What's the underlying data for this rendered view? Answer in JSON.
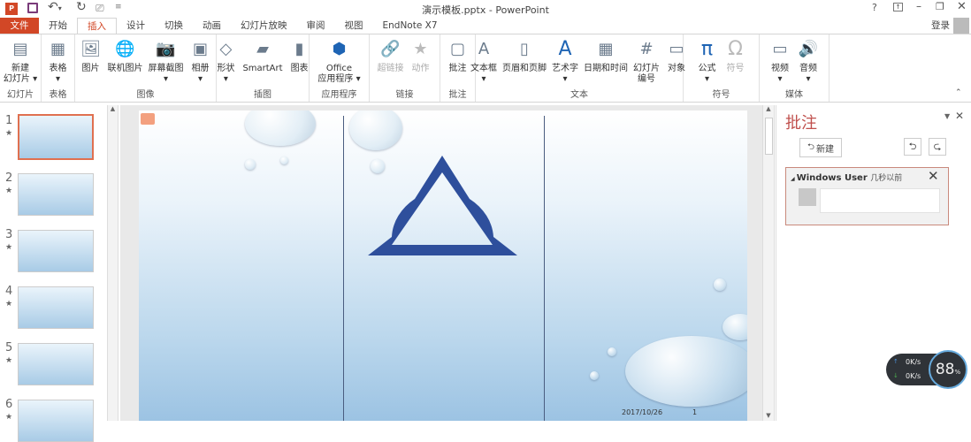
{
  "window": {
    "title": "演示模板.pptx - PowerPoint",
    "help": "?",
    "signin": "登录"
  },
  "tabs": [
    "文件",
    "开始",
    "插入",
    "设计",
    "切换",
    "动画",
    "幻灯片放映",
    "审阅",
    "视图",
    "EndNote X7"
  ],
  "ribbon": {
    "groups": [
      {
        "label": "幻灯片",
        "buttons": [
          {
            "label": "新建\n幻灯片 ▾",
            "icon": "new-slide-icon"
          }
        ]
      },
      {
        "label": "表格",
        "buttons": [
          {
            "label": "表格\n▾",
            "icon": "table-icon"
          }
        ]
      },
      {
        "label": "图像",
        "buttons": [
          {
            "label": "图片",
            "icon": "picture-icon"
          },
          {
            "label": "联机图片",
            "icon": "online-picture-icon"
          },
          {
            "label": "屏幕截图\n▾",
            "icon": "screenshot-icon"
          },
          {
            "label": "相册\n▾",
            "icon": "photo-album-icon"
          }
        ]
      },
      {
        "label": "插图",
        "buttons": [
          {
            "label": "形状\n▾",
            "icon": "shapes-icon"
          },
          {
            "label": "SmartArt",
            "icon": "smartart-icon"
          },
          {
            "label": "图表",
            "icon": "chart-icon"
          }
        ]
      },
      {
        "label": "应用程序",
        "buttons": [
          {
            "label": "Office\n应用程序 ▾",
            "icon": "office-apps-icon"
          }
        ]
      },
      {
        "label": "链接",
        "buttons": [
          {
            "label": "超链接",
            "icon": "hyperlink-icon",
            "disabled": true
          },
          {
            "label": "动作",
            "icon": "action-icon",
            "disabled": true
          }
        ]
      },
      {
        "label": "批注",
        "buttons": [
          {
            "label": "批注",
            "icon": "comment-icon"
          }
        ]
      },
      {
        "label": "文本",
        "buttons": [
          {
            "label": "文本框\n▾",
            "icon": "textbox-icon"
          },
          {
            "label": "页眉和页脚",
            "icon": "header-footer-icon"
          },
          {
            "label": "艺术字\n▾",
            "icon": "wordart-icon"
          },
          {
            "label": "日期和时间",
            "icon": "date-time-icon"
          },
          {
            "label": "幻灯片\n编号",
            "icon": "slide-number-icon"
          },
          {
            "label": "对象",
            "icon": "object-icon"
          }
        ]
      },
      {
        "label": "符号",
        "buttons": [
          {
            "label": "公式\n▾",
            "icon": "equation-icon"
          },
          {
            "label": "符号",
            "icon": "symbol-icon",
            "disabled": true
          }
        ]
      },
      {
        "label": "媒体",
        "buttons": [
          {
            "label": "视频\n▾",
            "icon": "video-icon"
          },
          {
            "label": "音频\n▾",
            "icon": "audio-icon"
          }
        ]
      }
    ]
  },
  "thumbnails": [
    {
      "num": "1",
      "star": "★"
    },
    {
      "num": "2",
      "star": "★"
    },
    {
      "num": "3",
      "star": "★"
    },
    {
      "num": "4",
      "star": "★"
    },
    {
      "num": "5",
      "star": "★"
    },
    {
      "num": "6",
      "star": "★"
    }
  ],
  "slide": {
    "date": "2017/10/26",
    "page": "1",
    "accent": "#2e4f9c"
  },
  "comments": {
    "title": "批注",
    "new_label": "新建",
    "author": "Windows User",
    "time": "几秒以前",
    "input_value": ""
  },
  "netmon": {
    "up": "0K/s",
    "down": "0K/s",
    "percent": "88",
    "unit": "%"
  }
}
